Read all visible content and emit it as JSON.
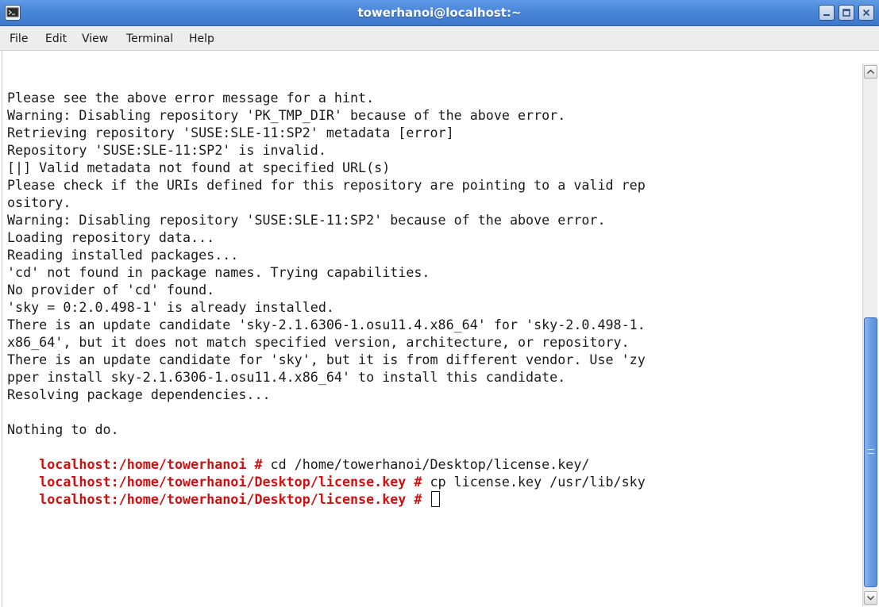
{
  "window": {
    "title": "towerhanoi@localhost:~",
    "icon": "terminal-icon",
    "buttons": [
      "minimize-icon",
      "maximize-icon",
      "close-icon"
    ],
    "accent": "#4a86d9"
  },
  "menu": {
    "items": [
      "File",
      "Edit",
      "View",
      "Terminal",
      "Help"
    ]
  },
  "terminal": {
    "prompt_color": "#d01010",
    "lines": [
      "Please see the above error message for a hint.",
      "Warning: Disabling repository 'PK_TMP_DIR' because of the above error.",
      "Retrieving repository 'SUSE:SLE-11:SP2' metadata [error]",
      "Repository 'SUSE:SLE-11:SP2' is invalid.",
      "[|] Valid metadata not found at specified URL(s)",
      "Please check if the URIs defined for this repository are pointing to a valid rep",
      "ository.",
      "Warning: Disabling repository 'SUSE:SLE-11:SP2' because of the above error.",
      "Loading repository data...",
      "Reading installed packages...",
      "'cd' not found in package names. Trying capabilities.",
      "No provider of 'cd' found.",
      "'sky = 0:2.0.498-1' is already installed.",
      "There is an update candidate 'sky-2.1.6306-1.osu11.4.x86_64' for 'sky-2.0.498-1.",
      "x86_64', but it does not match specified version, architecture, or repository.",
      "There is an update candidate for 'sky', but it is from different vendor. Use 'zy",
      "pper install sky-2.1.6306-1.osu11.4.x86_64' to install this candidate.",
      "Resolving package dependencies...",
      "",
      "Nothing to do."
    ],
    "commands": [
      {
        "prompt": "localhost:/home/towerhanoi # ",
        "command": "cd /home/towerhanoi/Desktop/license.key/"
      },
      {
        "prompt": "localhost:/home/towerhanoi/Desktop/license.key # ",
        "command": "cp license.key /usr/lib/sky"
      },
      {
        "prompt": "localhost:/home/towerhanoi/Desktop/license.key # ",
        "command": ""
      }
    ]
  },
  "scrollbar": {
    "position_fraction": 0.52,
    "visible_fraction": 0.48
  }
}
